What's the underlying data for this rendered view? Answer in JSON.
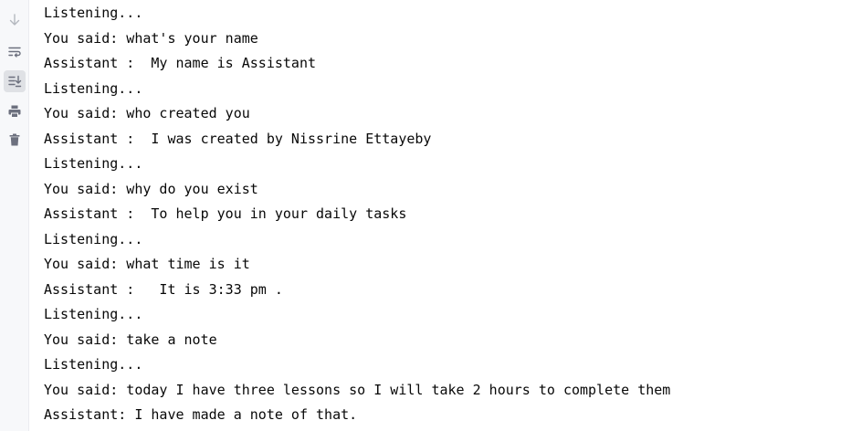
{
  "toolbar": {
    "buttons": [
      {
        "icon": "arrow-down-icon",
        "tooltip": "Down",
        "active": false
      },
      {
        "icon": "soft-wrap-icon",
        "tooltip": "Soft-Wrap",
        "active": false
      },
      {
        "icon": "scroll-to-end-icon",
        "tooltip": "Scroll to the end",
        "active": true
      },
      {
        "icon": "print-icon",
        "tooltip": "Print",
        "active": false
      },
      {
        "icon": "trash-icon",
        "tooltip": "Clear All",
        "active": false
      }
    ]
  },
  "console": {
    "lines": [
      "Listening...",
      "You said: what's your name",
      "Assistant :  My name is Assistant",
      "Listening...",
      "You said: who created you",
      "Assistant :  I was created by Nissrine Ettayeby",
      "Listening...",
      "You said: why do you exist",
      "Assistant :  To help you in your daily tasks",
      "Listening...",
      "You said: what time is it",
      "Assistant :   It is 3:33 pm .",
      "Listening...",
      "You said: take a note",
      "Listening...",
      "You said: today I have three lessons so I will take 2 hours to complete them",
      "Assistant: I have made a note of that."
    ]
  },
  "colors": {
    "text": "#080808",
    "toolbar_bg": "#f7f8fa",
    "active_button_bg": "#dfe1e5",
    "icon": "#6c707e",
    "icon_disabled": "#b4b8bf"
  }
}
